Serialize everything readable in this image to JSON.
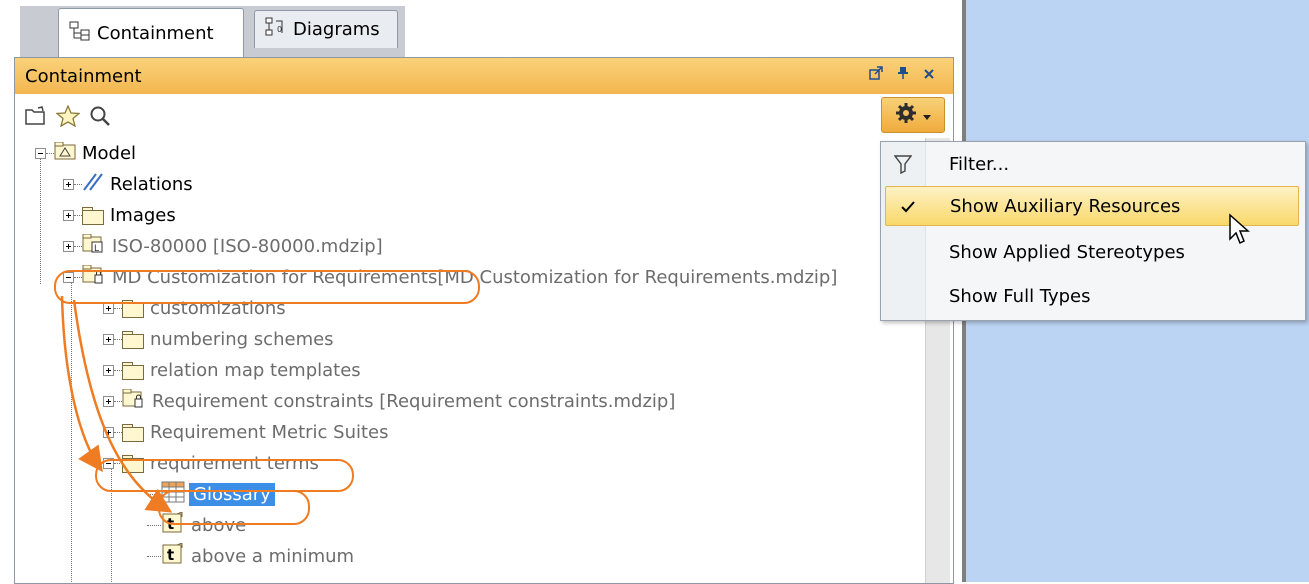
{
  "tabs": [
    {
      "label": "Containment",
      "icon": "containment-icon",
      "active": true
    },
    {
      "label": "Diagrams",
      "icon": "diagrams-icon",
      "active": false
    }
  ],
  "panel": {
    "title": "Containment"
  },
  "toolbar": {
    "buttons": [
      "open-folder-icon",
      "star-icon",
      "search-icon"
    ],
    "options_button": "gear-icon"
  },
  "tree": [
    {
      "label": "Model",
      "icon": "model-icon",
      "expander": "minus"
    },
    {
      "label": "Relations",
      "icon": "relations-icon",
      "expander": "plus"
    },
    {
      "label": "Images",
      "icon": "folder-icon",
      "expander": "plus"
    },
    {
      "label": "ISO-80000 [ISO-80000.mdzip]",
      "icon": "used-project-icon",
      "expander": "plus",
      "gray": true
    },
    {
      "label": "MD Customization for Requirements",
      "suffix": " [MD Customization for Requirements.mdzip]",
      "icon": "used-project-icon",
      "expander": "minus",
      "gray": true
    },
    {
      "label": "customizations",
      "icon": "folder-icon",
      "expander": "plus",
      "gray": true
    },
    {
      "label": "numbering schemes",
      "icon": "folder-icon",
      "expander": "plus",
      "gray": true
    },
    {
      "label": "relation map templates",
      "icon": "folder-icon",
      "expander": "plus",
      "gray": true
    },
    {
      "label": "Requirement constraints [Requirement constraints.mdzip]",
      "icon": "used-project-icon",
      "expander": "plus",
      "gray": true
    },
    {
      "label": "Requirement Metric Suites",
      "icon": "folder-icon",
      "expander": "plus",
      "gray": true
    },
    {
      "label": "requirement terms",
      "icon": "folder-icon",
      "expander": "minus",
      "gray": true
    },
    {
      "label": "Glossary",
      "icon": "table-icon",
      "selected": true
    },
    {
      "label": "above",
      "icon": "term-icon",
      "gray": true
    },
    {
      "label": "above a minimum",
      "icon": "term-icon",
      "gray": true
    }
  ],
  "menu": {
    "items": [
      {
        "label": "Filter...",
        "icon": "filter-icon"
      },
      {
        "label": "Show Auxiliary Resources",
        "icon": "checkmark-icon",
        "checked": true,
        "highlighted": true
      },
      {
        "label": "Show Applied Stereotypes"
      },
      {
        "label": "Show Full Types"
      }
    ]
  },
  "colors": {
    "accent_orange": "#ef7b22",
    "titlebar": "#f3b64f",
    "selection": "#3d8ee6",
    "right_pane": "#bcd4f4"
  }
}
